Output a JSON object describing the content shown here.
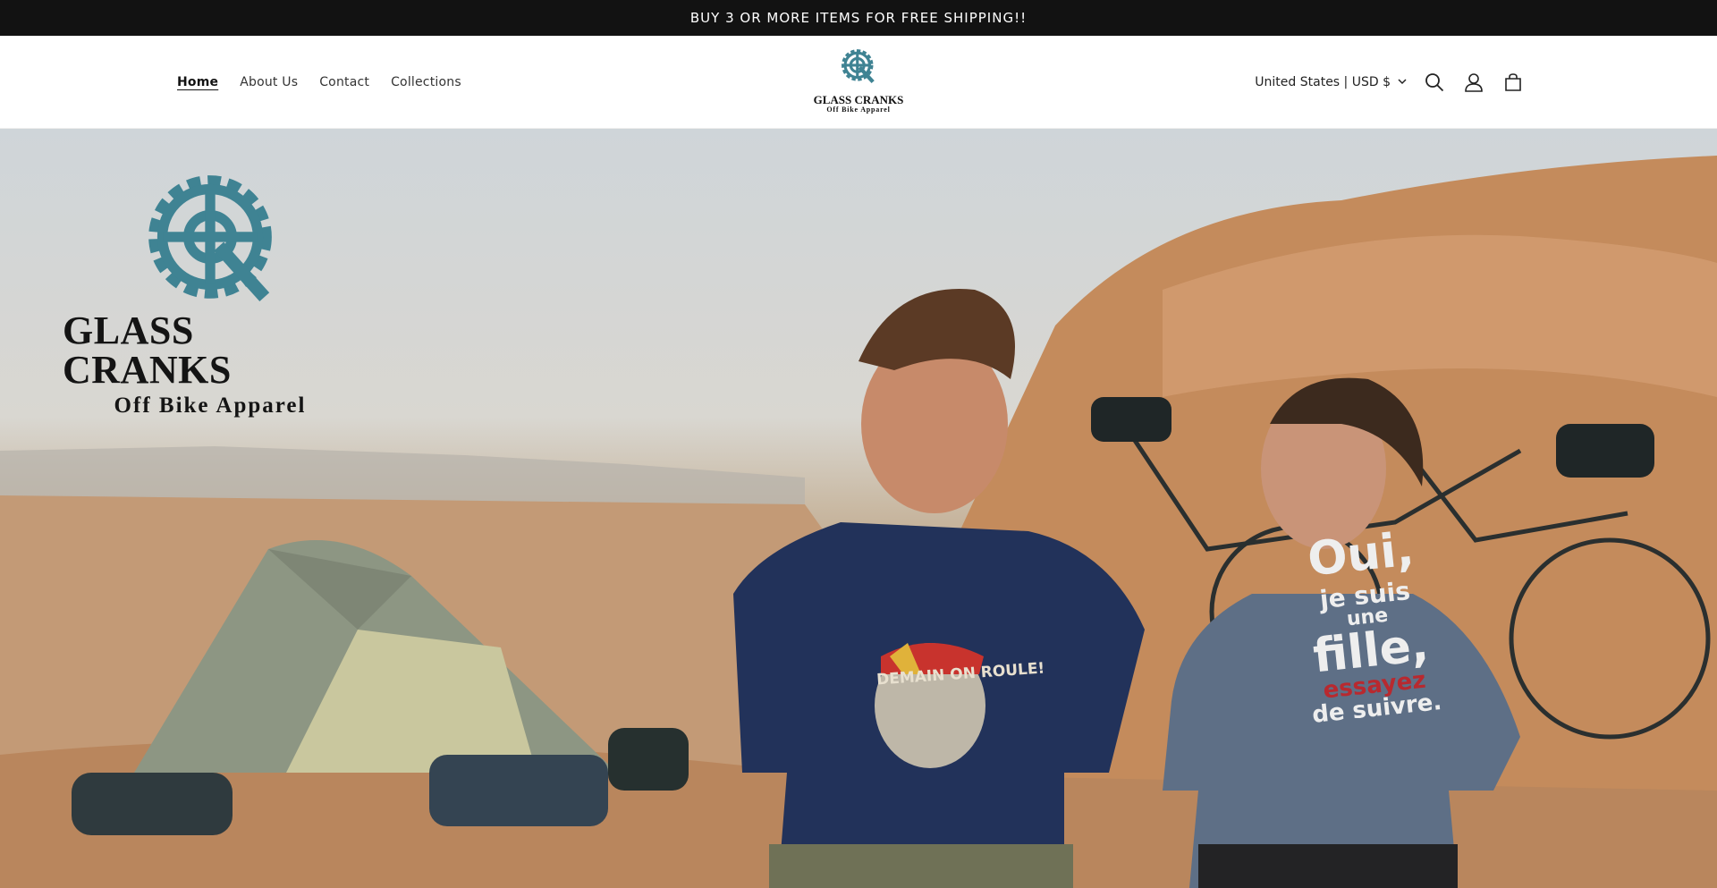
{
  "announcement": {
    "text": "BUY 3 OR MORE ITEMS FOR FREE SHIPPING!!"
  },
  "nav": {
    "items": [
      {
        "label": "Home",
        "active": true
      },
      {
        "label": "About Us"
      },
      {
        "label": "Contact"
      },
      {
        "label": "Collections"
      }
    ]
  },
  "logo": {
    "brand": "GLASS CRANKS",
    "tagline": "Off Bike Apparel"
  },
  "header_right": {
    "country_selector": "United States | USD $",
    "icons": [
      "search-icon",
      "account-icon",
      "cart-icon"
    ]
  },
  "hero": {
    "brand": "GLASS CRANKS",
    "tagline": "Off Bike Apparel",
    "shirt_1_text": "DEMAIN ON ROULE!",
    "shirt_2_lines": [
      "Oui,",
      "je suis",
      "une",
      "fille,",
      "essayez",
      "de suivre."
    ]
  },
  "colors": {
    "announcement_bg": "#121212",
    "logo_teal": "#3f8393"
  }
}
